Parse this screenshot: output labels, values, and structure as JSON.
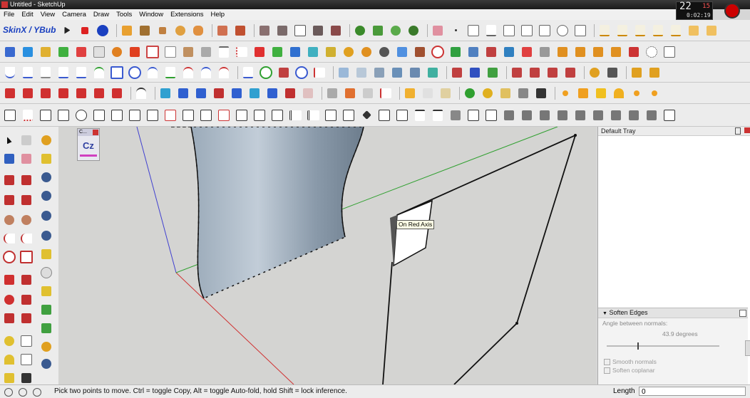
{
  "window": {
    "title": "Untitled - SketchUp"
  },
  "menu": [
    "File",
    "Edit",
    "View",
    "Camera",
    "Draw",
    "Tools",
    "Window",
    "Extensions",
    "Help"
  ],
  "clock": {
    "value": "22",
    "time": "0:02:19",
    "fps": "15"
  },
  "toolbar": {
    "plugin_label": "SkinX / YBub"
  },
  "viewport": {
    "tooltip": "On Red Axis",
    "mini_panel_label": "C...",
    "mini_panel_icon": "Cz"
  },
  "tray": {
    "title": "Default Tray",
    "soften": {
      "title": "Soften Edges",
      "angle_label": "Angle between normals:",
      "angle_value": "43.9  degrees",
      "smooth_label": "Smooth normals",
      "coplanar_label": "Soften coplanar",
      "slider_fraction": 0.27
    }
  },
  "status": {
    "hint": "Pick two points to move.  Ctrl = toggle Copy, Alt = toggle Auto-fold, hold Shift = lock inference.",
    "length_label": "Length",
    "length_value": "0"
  },
  "colors": {
    "accent": "#1a40c0",
    "surface_top": "#9aa9b8",
    "axis_red": "#d03030",
    "axis_green": "#30a030",
    "axis_blue": "#3030d0"
  }
}
